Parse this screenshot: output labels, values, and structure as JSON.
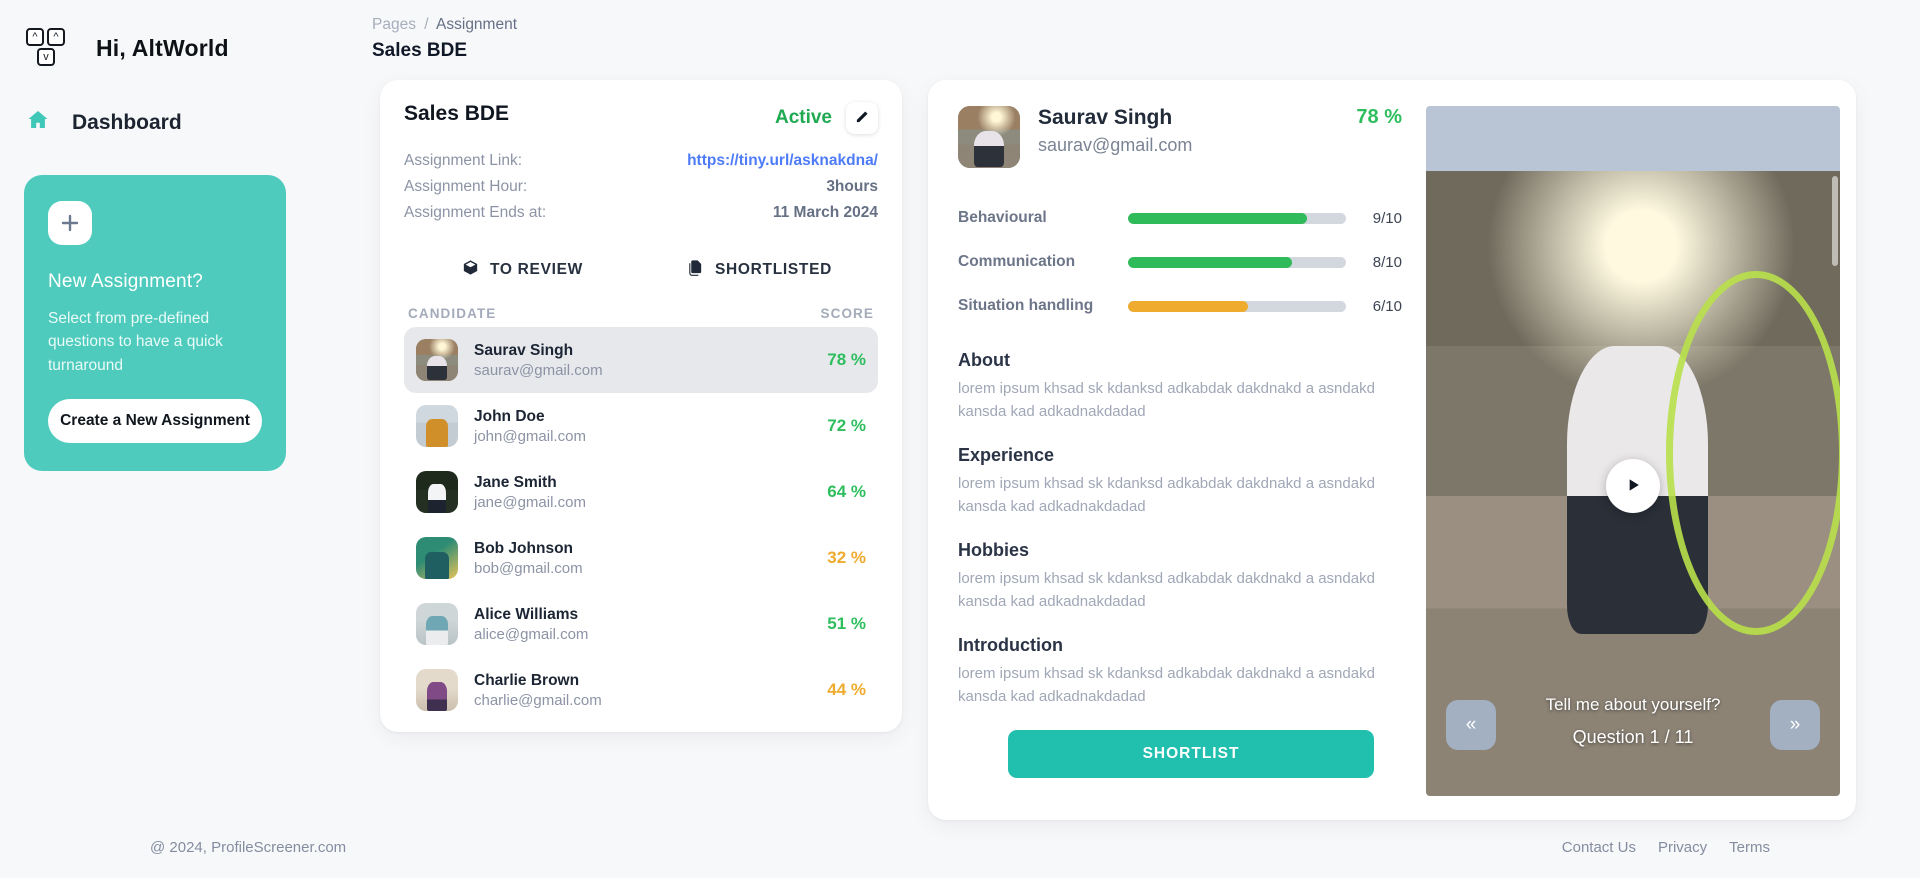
{
  "brand": {
    "greeting": "Hi, AltWorld",
    "logo_icon": "arrow-keys-logo-icon"
  },
  "sidebar": {
    "nav": [
      {
        "label": "Dashboard",
        "icon": "home-icon"
      }
    ],
    "promo": {
      "icon": "plus-icon",
      "title": "New Assignment?",
      "subtitle": "Select from pre-defined questions to have a quick turnaround",
      "button": "Create a New Assignment"
    }
  },
  "breadcrumb": {
    "root": "Pages",
    "separator": "/",
    "current": "Assignment",
    "title": "Sales BDE"
  },
  "assignment": {
    "title": "Sales BDE",
    "status": "Active",
    "status_color": "#1faa51",
    "edit_icon": "pencil-icon",
    "meta": [
      {
        "key": "Assignment Link:",
        "value": "https://tiny.url/asknakdna/",
        "is_link": true
      },
      {
        "key": "Assignment Hour:",
        "value": "3hours",
        "is_link": false
      },
      {
        "key": "Assignment Ends at:",
        "value": "11 March 2024",
        "is_link": false
      }
    ],
    "tabs": [
      {
        "label": "TO REVIEW",
        "icon": "cube-icon",
        "active": true
      },
      {
        "label": "SHORTLISTED",
        "icon": "documents-icon",
        "active": false
      }
    ],
    "columns": {
      "candidate": "CANDIDATE",
      "score": "SCORE"
    },
    "candidates": [
      {
        "name": "Saurav Singh",
        "email": "saurav@gmail.com",
        "score": "78 %",
        "color": "#2ebe5d",
        "selected": true,
        "photo": "ph-saurav"
      },
      {
        "name": "John Doe",
        "email": "john@gmail.com",
        "score": "72 %",
        "color": "#2ebe5d",
        "selected": false,
        "photo": "ph-john"
      },
      {
        "name": "Jane Smith",
        "email": "jane@gmail.com",
        "score": "64 %",
        "color": "#2ebe5d",
        "selected": false,
        "photo": "ph-jane"
      },
      {
        "name": "Bob Johnson",
        "email": "bob@gmail.com",
        "score": "32 %",
        "color": "#eeab2d",
        "selected": false,
        "photo": "ph-bob"
      },
      {
        "name": "Alice Williams",
        "email": "alice@gmail.com",
        "score": "51 %",
        "color": "#2ebe5d",
        "selected": false,
        "photo": "ph-alice"
      },
      {
        "name": "Charlie Brown",
        "email": "charlie@gmail.com",
        "score": "44 %",
        "color": "#eeab2d",
        "selected": false,
        "photo": "ph-charlie"
      }
    ]
  },
  "profile": {
    "name": "Saurav Singh",
    "email": "saurav@gmail.com",
    "score": "78 %",
    "score_color": "#2ebe5d",
    "skills": [
      {
        "name": "Behavioural",
        "value": "9/10",
        "pct": 82,
        "color": "#30bb5b"
      },
      {
        "name": "Communication",
        "value": "8/10",
        "pct": 75,
        "color": "#30bb5b"
      },
      {
        "name": "Situation handling",
        "value": "6/10",
        "pct": 55,
        "color": "#eeab2d"
      }
    ],
    "sections": [
      {
        "title": "About",
        "body": "lorem ipsum khsad sk kdanksd adkabdak dakdnakd a asndakd kansda kad adkadnakdadad"
      },
      {
        "title": "Experience",
        "body": "lorem ipsum khsad sk kdanksd adkabdak dakdnakd a asndakd kansda kad adkadnakdadad"
      },
      {
        "title": "Hobbies",
        "body": "lorem ipsum khsad sk kdanksd adkabdak dakdnakd a asndakd kansda kad adkadnakdadad"
      },
      {
        "title": "Introduction",
        "body": "lorem ipsum khsad sk kdanksd adkabdak dakdnakd a asndakd kansda kad adkadnakdadad"
      }
    ],
    "shortlist_button": "SHORTLIST",
    "video": {
      "play_icon": "play-icon",
      "question": "Tell me about yourself?",
      "counter": "Question 1 / 11",
      "prev_label": "«",
      "next_label": "»"
    }
  },
  "footer": {
    "copyright": "@ 2024, ProfileScreener.com",
    "links": [
      "Contact Us",
      "Privacy",
      "Terms"
    ]
  },
  "theme": {
    "accent": "#4ecbbd",
    "button": "#21bfad",
    "green": "#2ebe5d",
    "amber": "#eeab2d",
    "link": "#4e7bf8"
  }
}
